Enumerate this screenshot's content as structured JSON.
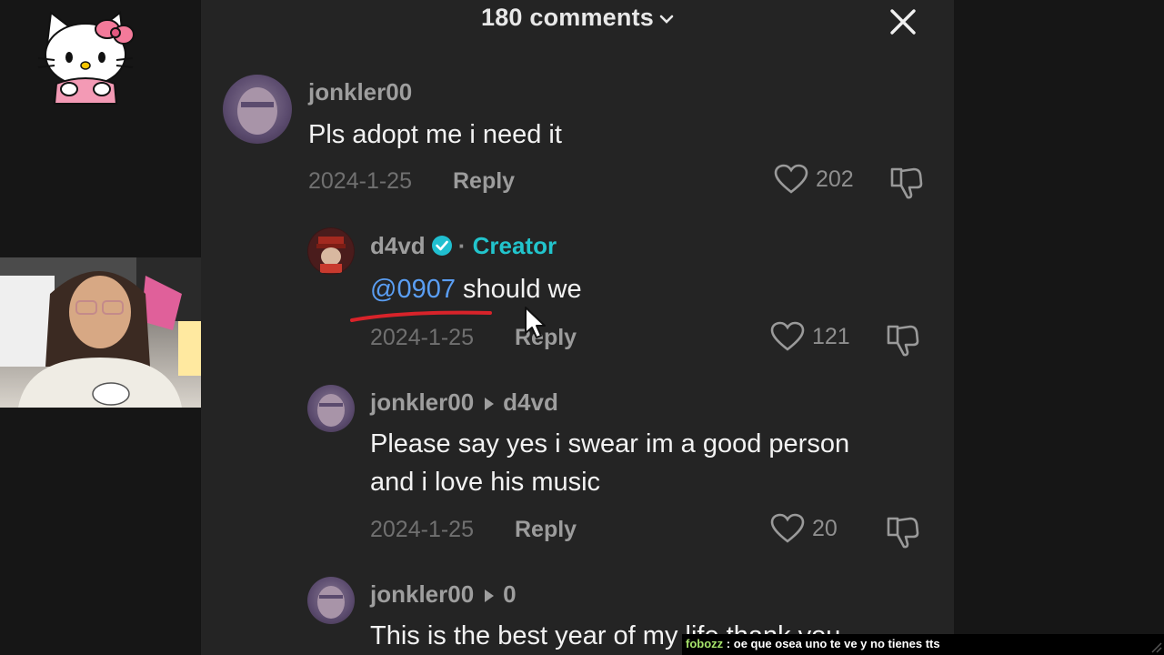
{
  "header": {
    "title": "180 comments",
    "icons": [
      "chevron-down-icon",
      "close-icon"
    ]
  },
  "comments": [
    {
      "username": "jonkler00",
      "text": "Pls adopt me i need it",
      "date": "2024-1-25",
      "reply_label": "Reply",
      "likes": "202"
    },
    {
      "username": "d4vd",
      "separator": "·",
      "badge": "Creator",
      "mention": "@0907",
      "text": "should we",
      "date": "2024-1-25",
      "reply_label": "Reply",
      "likes": "121"
    },
    {
      "username": "jonkler00",
      "reply_to": "d4vd",
      "text_line1": "Please say yes i swear im a good person",
      "text_line2": "and i love his music",
      "date": "2024-1-25",
      "reply_label": "Reply",
      "likes": "20"
    },
    {
      "username": "jonkler00",
      "reply_to": "0",
      "text": "This is the best year of my life thank you"
    }
  ],
  "chat": {
    "user": "fobozz",
    "separator": ":",
    "message": "oe que osea uno te ve y no tienes tts"
  },
  "colors": {
    "panel_bg": "#242424",
    "creator": "#22c4cc",
    "mention": "#5a9ef3",
    "underline_mark": "#d8232a",
    "chat_user": "#a6e36b"
  }
}
